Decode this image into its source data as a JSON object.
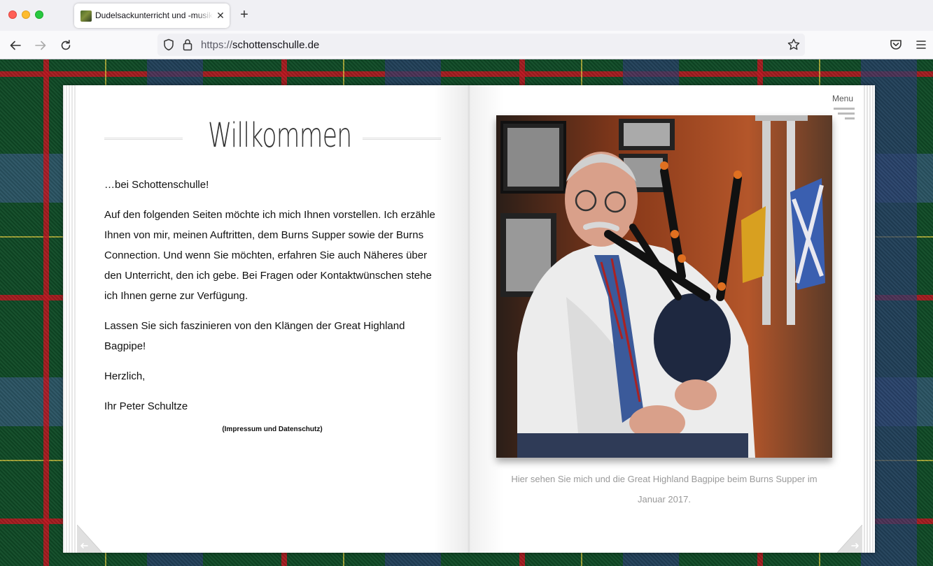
{
  "browser": {
    "tab_title": "Dudelsackunterricht und -musik",
    "url_protocol": "https://",
    "url_host": "schottenschulle.de"
  },
  "page": {
    "title": "Willkommen",
    "greeting": "…bei Schottenschulle!",
    "paragraph_1": "Auf den folgenden Seiten möchte ich mich Ihnen vorstellen. Ich erzähle Ihnen von mir, meinen Auftritten, dem Burns Supper sowie der Burns Connection. Und wenn Sie möchten, erfahren Sie auch Näheres über den Unterricht, den ich gebe. Bei Fragen oder Kontaktwünschen stehe ich Ihnen gerne zur Verfügung.",
    "paragraph_2": "Lassen Sie sich faszinieren von den Klängen der Great Highland Bagpipe!",
    "closing": "Herzlich,",
    "signature": "Ihr Peter Schultze",
    "imprint_link": "(Impressum und Datenschutz)",
    "menu_label": "Menu",
    "photo_caption": "Hier sehen Sie mich und die Great Highland Bagpipe beim Burns Supper im Januar 2017."
  },
  "colors": {
    "tartan_green": "#0f4a26",
    "tartan_red": "#be141e",
    "caption_gray": "#999999"
  }
}
